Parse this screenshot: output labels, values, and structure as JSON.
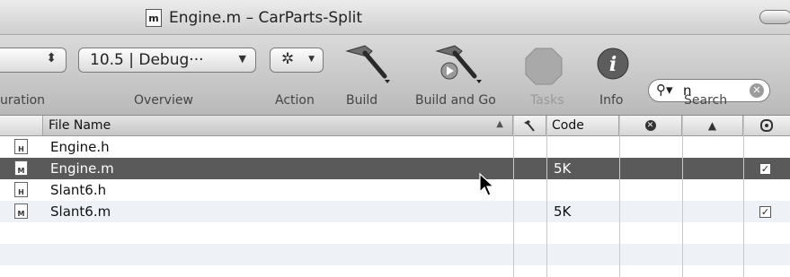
{
  "window": {
    "title": "Engine.m – CarParts-Split",
    "title_icon": "m"
  },
  "toolbar": {
    "configuration_label": "uration",
    "overview_value": "10.5 | Debug···",
    "overview_label": "Overview",
    "action_label": "Action",
    "build_label": "Build",
    "build_and_go_label": "Build and Go",
    "tasks_label": "Tasks",
    "info_label": "Info",
    "search_value": "n",
    "search_label": "Search"
  },
  "table": {
    "columns": {
      "file_name": "File Name",
      "code": "Code"
    },
    "rows": [
      {
        "icon": "H",
        "name": "Engine.h",
        "code": "",
        "checked": false,
        "selected": false
      },
      {
        "icon": "M",
        "name": "Engine.m",
        "code": "5K",
        "checked": true,
        "selected": true
      },
      {
        "icon": "H",
        "name": "Slant6.h",
        "code": "",
        "checked": false,
        "selected": false
      },
      {
        "icon": "M",
        "name": "Slant6.m",
        "code": "5K",
        "checked": true,
        "selected": false
      }
    ]
  },
  "icons": {
    "build": "hammer-icon",
    "build_and_go": "hammer-play-icon",
    "action": "gear-icon",
    "tasks": "stop-octagon-icon",
    "info": "info-icon",
    "search": "magnifier-icon",
    "clear": "clear-icon",
    "errors": "error-icon",
    "warnings": "warning-icon",
    "target": "target-icon",
    "sort": "sort-ascending-icon",
    "cursor": "arrow-cursor-icon"
  }
}
